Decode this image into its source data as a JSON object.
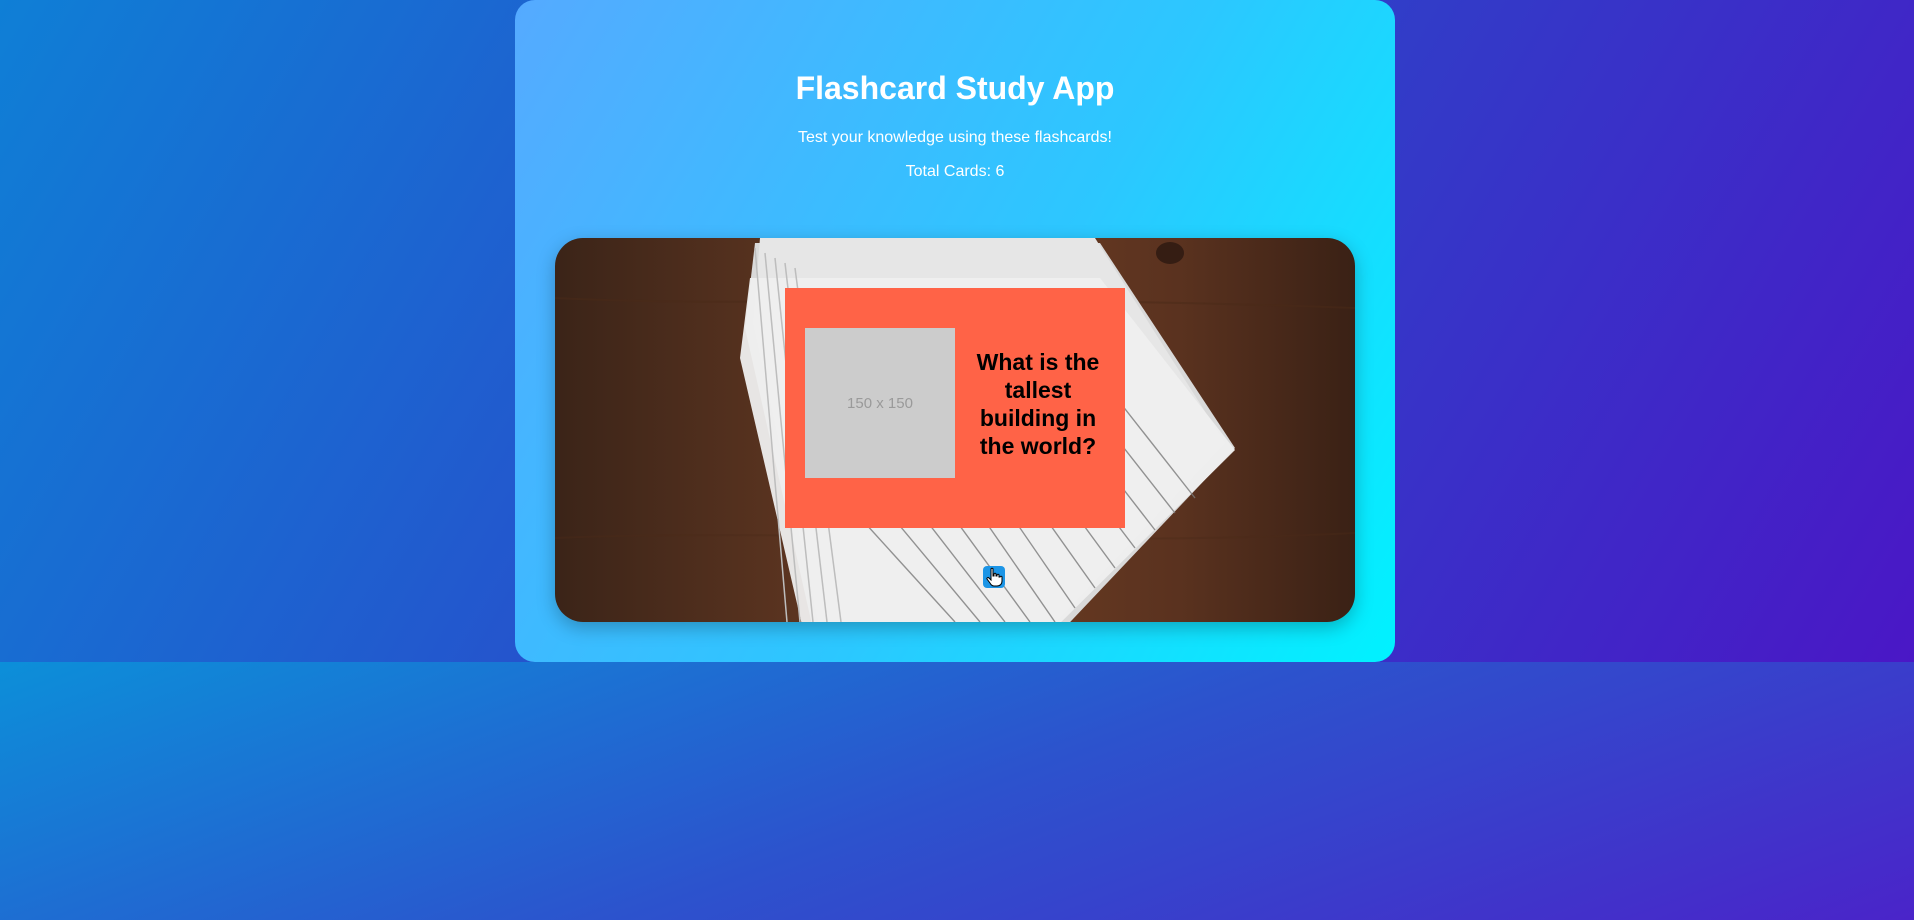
{
  "app": {
    "title": "Flashcard Study App",
    "subtitle": "Test your knowledge using these flashcards!",
    "total_cards_text": "Total Cards: 6"
  },
  "card": {
    "image_placeholder": "150 x 150",
    "question": "What is the tallest building in the world?",
    "background_color": "#ff6347"
  },
  "controls": {
    "flip_icon": "hand-pointer-icon"
  },
  "colors": {
    "panel_gradient_start": "#55aaff",
    "panel_gradient_end": "#00f2ff",
    "page_gradient_start": "#0f7fd6",
    "page_gradient_end": "#4a17c6",
    "button_color": "#1c95e6"
  }
}
